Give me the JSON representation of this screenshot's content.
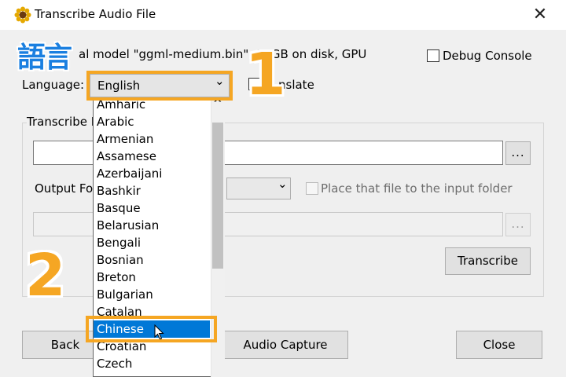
{
  "window": {
    "title": "Transcribe Audio File",
    "close_glyph": "✕",
    "app_icon": "sunflower-icon"
  },
  "overlay": {
    "word": "語言",
    "badge1": "1",
    "badge2": "2"
  },
  "model_info": "al model \"ggml-medium.bin\", 1.   GB on disk, GPU",
  "debug_console_label": "Debug Console",
  "language": {
    "label": "Language:",
    "selected": "English",
    "chevron": "⌄"
  },
  "translate_label": "nslate",
  "transcribe_group_label": "Transcribe F",
  "input_browse": "...",
  "output_format": {
    "label": "Output Fo",
    "chevron": "⌄"
  },
  "place_file_label": "Place that file to the input folder",
  "output_browse": "...",
  "dropdown": {
    "scroll_up": "^",
    "items": [
      "Amharic",
      "Arabic",
      "Armenian",
      "Assamese",
      "Azerbaijani",
      "Bashkir",
      "Basque",
      "Belarusian",
      "Bengali",
      "Bosnian",
      "Breton",
      "Bulgarian",
      "Catalan",
      "Chinese",
      "Croatian",
      "Czech"
    ],
    "highlighted": "Chinese"
  },
  "buttons": {
    "transcribe": "Transcribe",
    "back": "Back",
    "audio_capture": "Audio Capture",
    "close": "Close"
  },
  "colors": {
    "accent_orange": "#f5a623",
    "selection_blue": "#0078d7"
  }
}
